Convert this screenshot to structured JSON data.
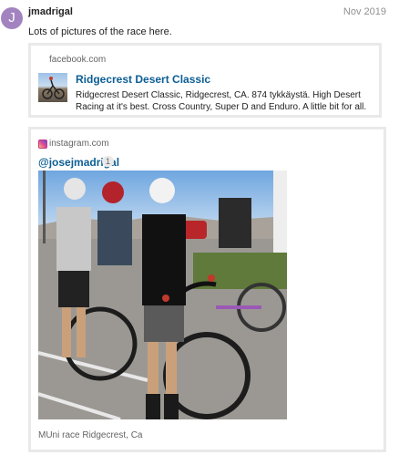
{
  "post": {
    "avatar_letter": "J",
    "avatar_color": "#a283c0",
    "username": "jmadrigal",
    "date": "Nov 2019",
    "text": "Lots of pictures of the race here."
  },
  "facebook_onebox": {
    "source": "facebook.com",
    "title": "Ridgecrest Desert Classic",
    "description": "Ridgecrest Desert Classic, Ridgecrest, CA. 874 tykkäystä. High Desert Racing at it's best. Cross Country, Super D and Enduro. A little bit for all."
  },
  "instagram_onebox": {
    "source": "instagram.com",
    "handle": "@josejmadrigal",
    "count": "1",
    "caption": "MUni race Ridgecrest, Ca"
  },
  "colors": {
    "link": "#0c5e94",
    "muted": "#646464",
    "border": "#e9e9e9"
  }
}
